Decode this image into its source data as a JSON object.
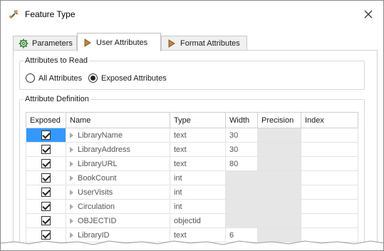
{
  "window": {
    "title": "Feature Type"
  },
  "tabs": [
    {
      "label": "Parameters",
      "icon": "gear-icon"
    },
    {
      "label": "User Attributes",
      "icon": "attribute-arrow-icon"
    },
    {
      "label": "Format Attributes",
      "icon": "attribute-arrow-icon"
    }
  ],
  "active_tab": "User Attributes",
  "attributes_to_read": {
    "legend": "Attributes to Read",
    "options": [
      "All Attributes",
      "Exposed Attributes"
    ],
    "selected": "Exposed Attributes"
  },
  "attribute_definition": {
    "legend": "Attribute Definition",
    "columns": [
      "Exposed",
      "Name",
      "Type",
      "Width",
      "Precision",
      "Index"
    ],
    "rows": [
      {
        "exposed": true,
        "name": "LibraryName",
        "type": "text",
        "width": "30",
        "precision": "",
        "index": "",
        "selected": true
      },
      {
        "exposed": true,
        "name": "LibraryAddress",
        "type": "text",
        "width": "30",
        "precision": "",
        "index": ""
      },
      {
        "exposed": true,
        "name": "LibraryURL",
        "type": "text",
        "width": "80",
        "precision": "",
        "index": ""
      },
      {
        "exposed": true,
        "name": "BookCount",
        "type": "int",
        "width": "",
        "precision": "",
        "index": ""
      },
      {
        "exposed": true,
        "name": "UserVisits",
        "type": "int",
        "width": "",
        "precision": "",
        "index": ""
      },
      {
        "exposed": true,
        "name": "Circulation",
        "type": "int",
        "width": "",
        "precision": "",
        "index": ""
      },
      {
        "exposed": true,
        "name": "OBJECTID",
        "type": "objectid",
        "width": "",
        "precision": "",
        "index": ""
      },
      {
        "exposed": true,
        "name": "LibraryID",
        "type": "text",
        "width": "6",
        "precision": "",
        "index": ""
      }
    ]
  },
  "colors": {
    "selection": "#3399ff",
    "disabled_cell": "#e6e6e6",
    "tab_icon": "#c8843a"
  }
}
